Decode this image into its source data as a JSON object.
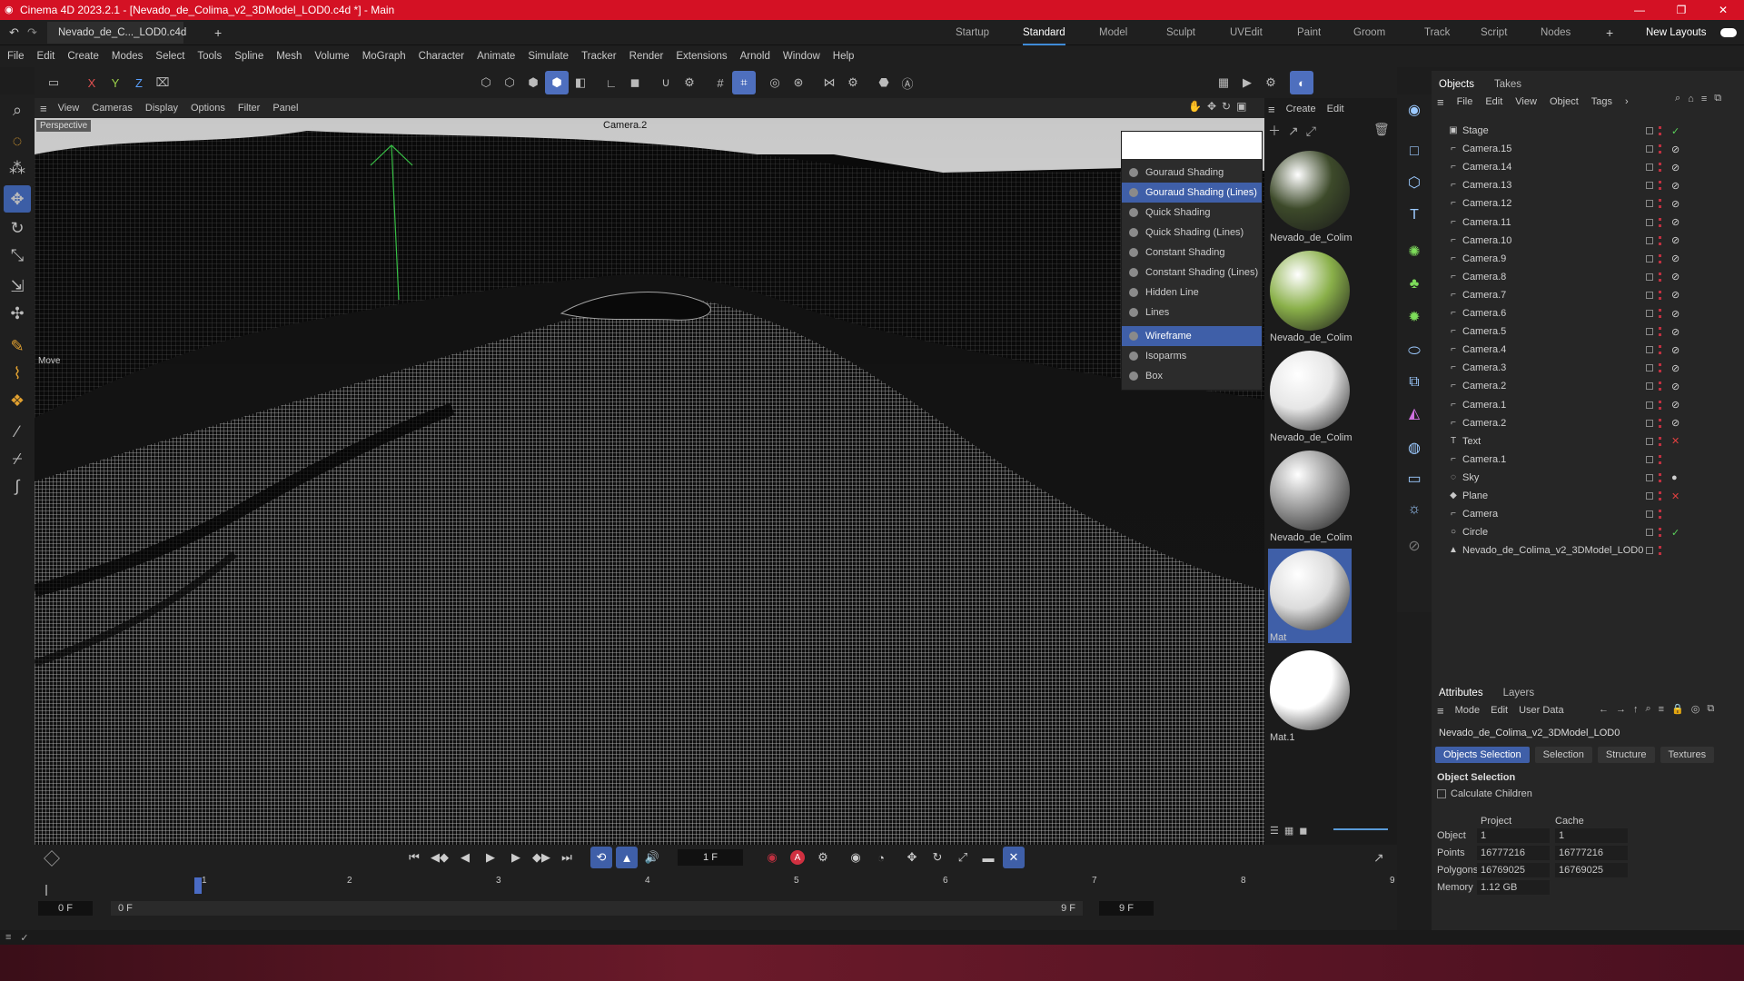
{
  "window": {
    "title": "Cinema 4D 2023.2.1 - [Nevado_de_Colima_v2_3DModel_LOD0.c4d *] - Main"
  },
  "doc_tab": {
    "label": "Nevado_de_C..._LOD0.c4d *"
  },
  "layouts": [
    "Startup",
    "Standard",
    "Model",
    "Sculpt",
    "UVEdit",
    "Paint",
    "Groom",
    "Track",
    "Script",
    "Nodes"
  ],
  "new_layouts": "New Layouts",
  "menu": [
    "File",
    "Edit",
    "Create",
    "Modes",
    "Select",
    "Tools",
    "Spline",
    "Mesh",
    "Volume",
    "MoGraph",
    "Character",
    "Animate",
    "Simulate",
    "Tracker",
    "Render",
    "Extensions",
    "Arnold",
    "Window",
    "Help"
  ],
  "axes": {
    "x": "X",
    "y": "Y",
    "z": "Z"
  },
  "viewport": {
    "menu": [
      "View",
      "Cameras",
      "Display",
      "Options",
      "Filter",
      "Panel"
    ],
    "label": "Perspective",
    "camera": "Camera.2",
    "tool_label": "Move"
  },
  "shading_menu": [
    {
      "label": "Gouraud Shading",
      "highlight": false
    },
    {
      "label": "Gouraud Shading (Lines)",
      "highlight": true
    },
    {
      "label": "Quick Shading",
      "highlight": false
    },
    {
      "label": "Quick Shading (Lines)",
      "highlight": false
    },
    {
      "label": "Constant Shading",
      "highlight": false
    },
    {
      "label": "Constant Shading (Lines)",
      "highlight": false
    },
    {
      "label": "Hidden Line",
      "highlight": false
    },
    {
      "label": "Lines",
      "highlight": false
    },
    {
      "label": "Wireframe",
      "highlight": true
    },
    {
      "label": "Isoparms",
      "highlight": false
    },
    {
      "label": "Box",
      "highlight": false
    }
  ],
  "materials": {
    "menu": [
      "Create",
      "Edit"
    ],
    "items": [
      {
        "label": "Nevado_de_Colim",
        "color": "#3d4a2a"
      },
      {
        "label": "Nevado_de_Colim",
        "color": "#8ab04a"
      },
      {
        "label": "Nevado_de_Colim",
        "color": "#e6e6e6"
      },
      {
        "label": "Nevado_de_Colim",
        "color": "#9a9a9a"
      },
      {
        "label": "Mat",
        "color": "#dcdcdc"
      },
      {
        "label": "Mat.1",
        "color": "#ffffff"
      }
    ]
  },
  "objects_panel": {
    "tabs": [
      "Objects",
      "Takes"
    ],
    "menu": [
      "File",
      "Edit",
      "View",
      "Object",
      "Tags"
    ],
    "items": [
      {
        "name": "Stage",
        "icon": "stage-icon",
        "tag": "✓"
      },
      {
        "name": "Camera.15",
        "icon": "camera-icon",
        "tag": "⊘"
      },
      {
        "name": "Camera.14",
        "icon": "camera-icon",
        "tag": "⊘"
      },
      {
        "name": "Camera.13",
        "icon": "camera-icon",
        "tag": "⊘"
      },
      {
        "name": "Camera.12",
        "icon": "camera-icon",
        "tag": "⊘"
      },
      {
        "name": "Camera.11",
        "icon": "camera-icon",
        "tag": "⊘"
      },
      {
        "name": "Camera.10",
        "icon": "camera-icon",
        "tag": "⊘"
      },
      {
        "name": "Camera.9",
        "icon": "camera-icon",
        "tag": "⊘"
      },
      {
        "name": "Camera.8",
        "icon": "camera-icon",
        "tag": "⊘"
      },
      {
        "name": "Camera.7",
        "icon": "camera-icon",
        "tag": "⊘"
      },
      {
        "name": "Camera.6",
        "icon": "camera-icon",
        "tag": "⊘"
      },
      {
        "name": "Camera.5",
        "icon": "camera-icon",
        "tag": "⊘"
      },
      {
        "name": "Camera.4",
        "icon": "camera-icon",
        "tag": "⊘"
      },
      {
        "name": "Camera.3",
        "icon": "camera-icon",
        "tag": "⊘"
      },
      {
        "name": "Camera.2",
        "icon": "camera-icon",
        "tag": "⊘"
      },
      {
        "name": "Camera.1",
        "icon": "camera-icon",
        "tag": "⊘"
      },
      {
        "name": "Camera.2",
        "icon": "camera-icon",
        "tag": "⊘"
      },
      {
        "name": "Text",
        "icon": "text-icon",
        "tag": "✕"
      },
      {
        "name": "Camera.1",
        "icon": "camera-icon",
        "tag": ""
      },
      {
        "name": "Sky",
        "icon": "sky-icon",
        "tag": "●"
      },
      {
        "name": "Plane",
        "icon": "plane-icon",
        "tag": "✕"
      },
      {
        "name": "Camera",
        "icon": "camera-icon",
        "tag": ""
      },
      {
        "name": "Circle",
        "icon": "circle-icon",
        "tag": "✓"
      },
      {
        "name": "Nevado_de_Colima_v2_3DModel_LOD0",
        "icon": "mesh-icon",
        "tag": ""
      }
    ]
  },
  "attributes": {
    "tabs": [
      "Attributes",
      "Layers"
    ],
    "menu": [
      "Mode",
      "Edit",
      "User Data"
    ],
    "object_name": "Nevado_de_Colima_v2_3DModel_LOD0",
    "buttons": [
      "Objects Selection",
      "Selection",
      "Structure",
      "Textures"
    ],
    "section": "Object Selection",
    "checkbox": "Calculate Children",
    "col_project": "Project",
    "col_cache": "Cache",
    "rows": [
      {
        "label": "Object",
        "project": "1",
        "cache": "1"
      },
      {
        "label": "Points",
        "project": "16777216",
        "cache": "16777216"
      },
      {
        "label": "Polygons",
        "project": "16769025",
        "cache": "16769025"
      },
      {
        "label": "Memory",
        "project": "1.12 GB",
        "cache": ""
      }
    ]
  },
  "timeline": {
    "current_frame": "1 F",
    "start": "0 F",
    "start2": "0 F",
    "end": "9 F",
    "end2": "9 F",
    "ticks": [
      "1",
      "2",
      "3",
      "4",
      "5",
      "6",
      "7",
      "8",
      "9"
    ],
    "playhead": 1
  }
}
